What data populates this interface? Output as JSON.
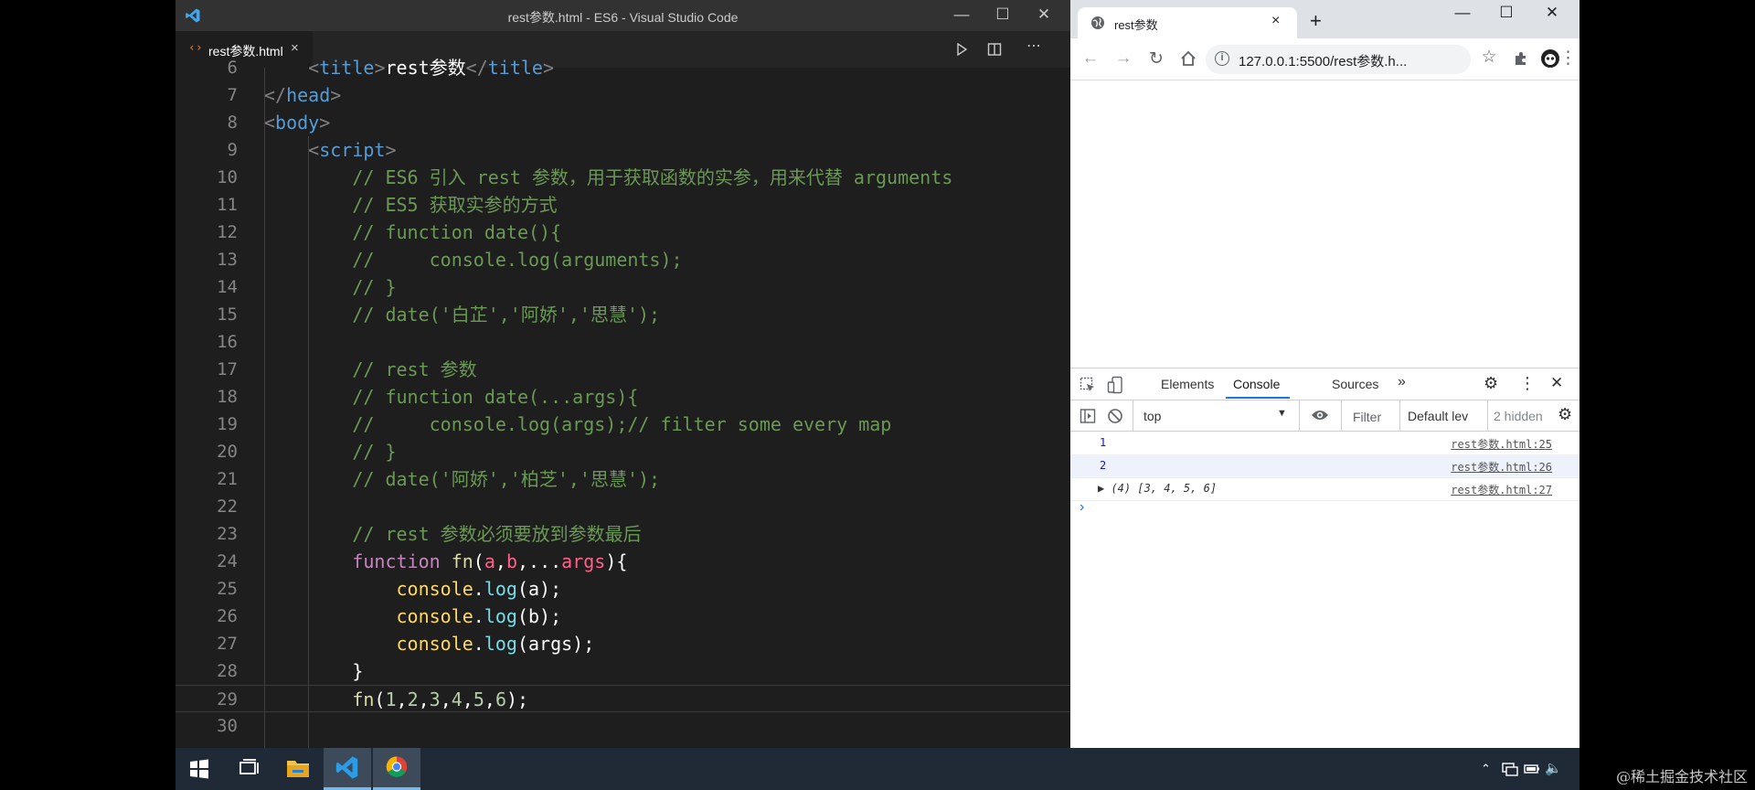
{
  "vscode": {
    "window_title": "rest参数.html - ES6 - Visual Studio Code",
    "tab_label": "rest参数.html",
    "tab_close": "×",
    "min": "—",
    "max": "☐",
    "close": "✕",
    "lines": [
      {
        "n": "6",
        "segs": [
          [
            "c-br",
            "    <"
          ],
          [
            "c-tag",
            "title"
          ],
          [
            "c-br",
            ">"
          ],
          [
            "c-txt",
            "rest参数"
          ],
          [
            "c-br",
            "</"
          ],
          [
            "c-tag",
            "title"
          ],
          [
            "c-br",
            ">"
          ]
        ]
      },
      {
        "n": "7",
        "segs": [
          [
            "c-br",
            "</"
          ],
          [
            "c-tag",
            "head"
          ],
          [
            "c-br",
            ">"
          ]
        ]
      },
      {
        "n": "8",
        "segs": [
          [
            "c-br",
            "<"
          ],
          [
            "c-tag",
            "body"
          ],
          [
            "c-br",
            ">"
          ]
        ]
      },
      {
        "n": "9",
        "segs": [
          [
            "c-br",
            "    <"
          ],
          [
            "c-tag",
            "script"
          ],
          [
            "c-br",
            ">"
          ]
        ]
      },
      {
        "n": "10",
        "segs": [
          [
            "c-com",
            "        // ES6 引入 rest 参数，用于获取函数的实参，用来代替 arguments"
          ]
        ]
      },
      {
        "n": "11",
        "segs": [
          [
            "c-com",
            "        // ES5 获取实参的方式"
          ]
        ]
      },
      {
        "n": "12",
        "segs": [
          [
            "c-com",
            "        // function date(){"
          ]
        ]
      },
      {
        "n": "13",
        "segs": [
          [
            "c-com",
            "        //     console.log(arguments);"
          ]
        ]
      },
      {
        "n": "14",
        "segs": [
          [
            "c-com",
            "        // }"
          ]
        ]
      },
      {
        "n": "15",
        "segs": [
          [
            "c-com",
            "        // date('白芷','阿娇','思慧');"
          ]
        ]
      },
      {
        "n": "16",
        "segs": []
      },
      {
        "n": "17",
        "segs": [
          [
            "c-com",
            "        // rest 参数"
          ]
        ]
      },
      {
        "n": "18",
        "segs": [
          [
            "c-com",
            "        // function date(...args){"
          ]
        ]
      },
      {
        "n": "19",
        "segs": [
          [
            "c-com",
            "        //     console.log(args);// filter some every map"
          ]
        ]
      },
      {
        "n": "20",
        "segs": [
          [
            "c-com",
            "        // }"
          ]
        ]
      },
      {
        "n": "21",
        "segs": [
          [
            "c-com",
            "        // date('阿娇','柏芝','思慧');"
          ]
        ]
      },
      {
        "n": "22",
        "segs": []
      },
      {
        "n": "23",
        "segs": [
          [
            "c-com",
            "        // rest 参数必须要放到参数最后"
          ]
        ]
      },
      {
        "n": "24",
        "segs": [
          [
            "c-kw",
            "        function "
          ],
          [
            "c-fn",
            "fn"
          ],
          [
            "c-txt",
            "("
          ],
          [
            "c-p",
            "a"
          ],
          [
            "c-txt",
            ","
          ],
          [
            "c-p",
            "b"
          ],
          [
            "c-txt",
            ","
          ],
          [
            "c-txt",
            "..."
          ],
          [
            "c-p",
            "args"
          ],
          [
            "c-txt",
            "){"
          ]
        ]
      },
      {
        "n": "25",
        "segs": [
          [
            "c-obj",
            "            console"
          ],
          [
            "c-txt",
            "."
          ],
          [
            "c-meth",
            "log"
          ],
          [
            "c-txt",
            "(a);"
          ]
        ]
      },
      {
        "n": "26",
        "segs": [
          [
            "c-obj",
            "            console"
          ],
          [
            "c-txt",
            "."
          ],
          [
            "c-meth",
            "log"
          ],
          [
            "c-txt",
            "(b);"
          ]
        ]
      },
      {
        "n": "27",
        "segs": [
          [
            "c-obj",
            "            console"
          ],
          [
            "c-txt",
            "."
          ],
          [
            "c-meth",
            "log"
          ],
          [
            "c-txt",
            "(args);"
          ]
        ]
      },
      {
        "n": "28",
        "segs": [
          [
            "c-txt",
            "        }"
          ]
        ]
      },
      {
        "n": "29",
        "segs": [
          [
            "c-fn",
            "        fn"
          ],
          [
            "c-txt",
            "("
          ],
          [
            "c-num",
            "1"
          ],
          [
            "c-txt",
            ","
          ],
          [
            "c-num",
            "2"
          ],
          [
            "c-txt",
            ","
          ],
          [
            "c-num",
            "3"
          ],
          [
            "c-txt",
            ","
          ],
          [
            "c-num",
            "4"
          ],
          [
            "c-txt",
            ","
          ],
          [
            "c-num",
            "5"
          ],
          [
            "c-txt",
            ","
          ],
          [
            "c-num",
            "6"
          ],
          [
            "c-txt",
            ");"
          ]
        ]
      },
      {
        "n": "30",
        "segs": []
      }
    ]
  },
  "chrome": {
    "tab_title": "rest参数",
    "tab_close": "×",
    "new_tab": "+",
    "url": "127.0.0.1:5500/rest参数.h...",
    "min": "—",
    "max": "☐",
    "close": "✕",
    "devtools": {
      "tabs": [
        "Elements",
        "Console",
        "Sources",
        "»"
      ],
      "context": "top",
      "filter_placeholder": "Filter",
      "levels": "Default lev",
      "hidden": "2 hidden",
      "rows": [
        {
          "value": "1",
          "src": "rest参数.html:25"
        },
        {
          "value": "2",
          "src": "rest参数.html:26"
        },
        {
          "value": "▶ (4) [3, 4, 5, 6]",
          "src": "rest参数.html:27"
        }
      ],
      "prompt": "›"
    }
  },
  "watermark": "@稀土掘金技术社区"
}
